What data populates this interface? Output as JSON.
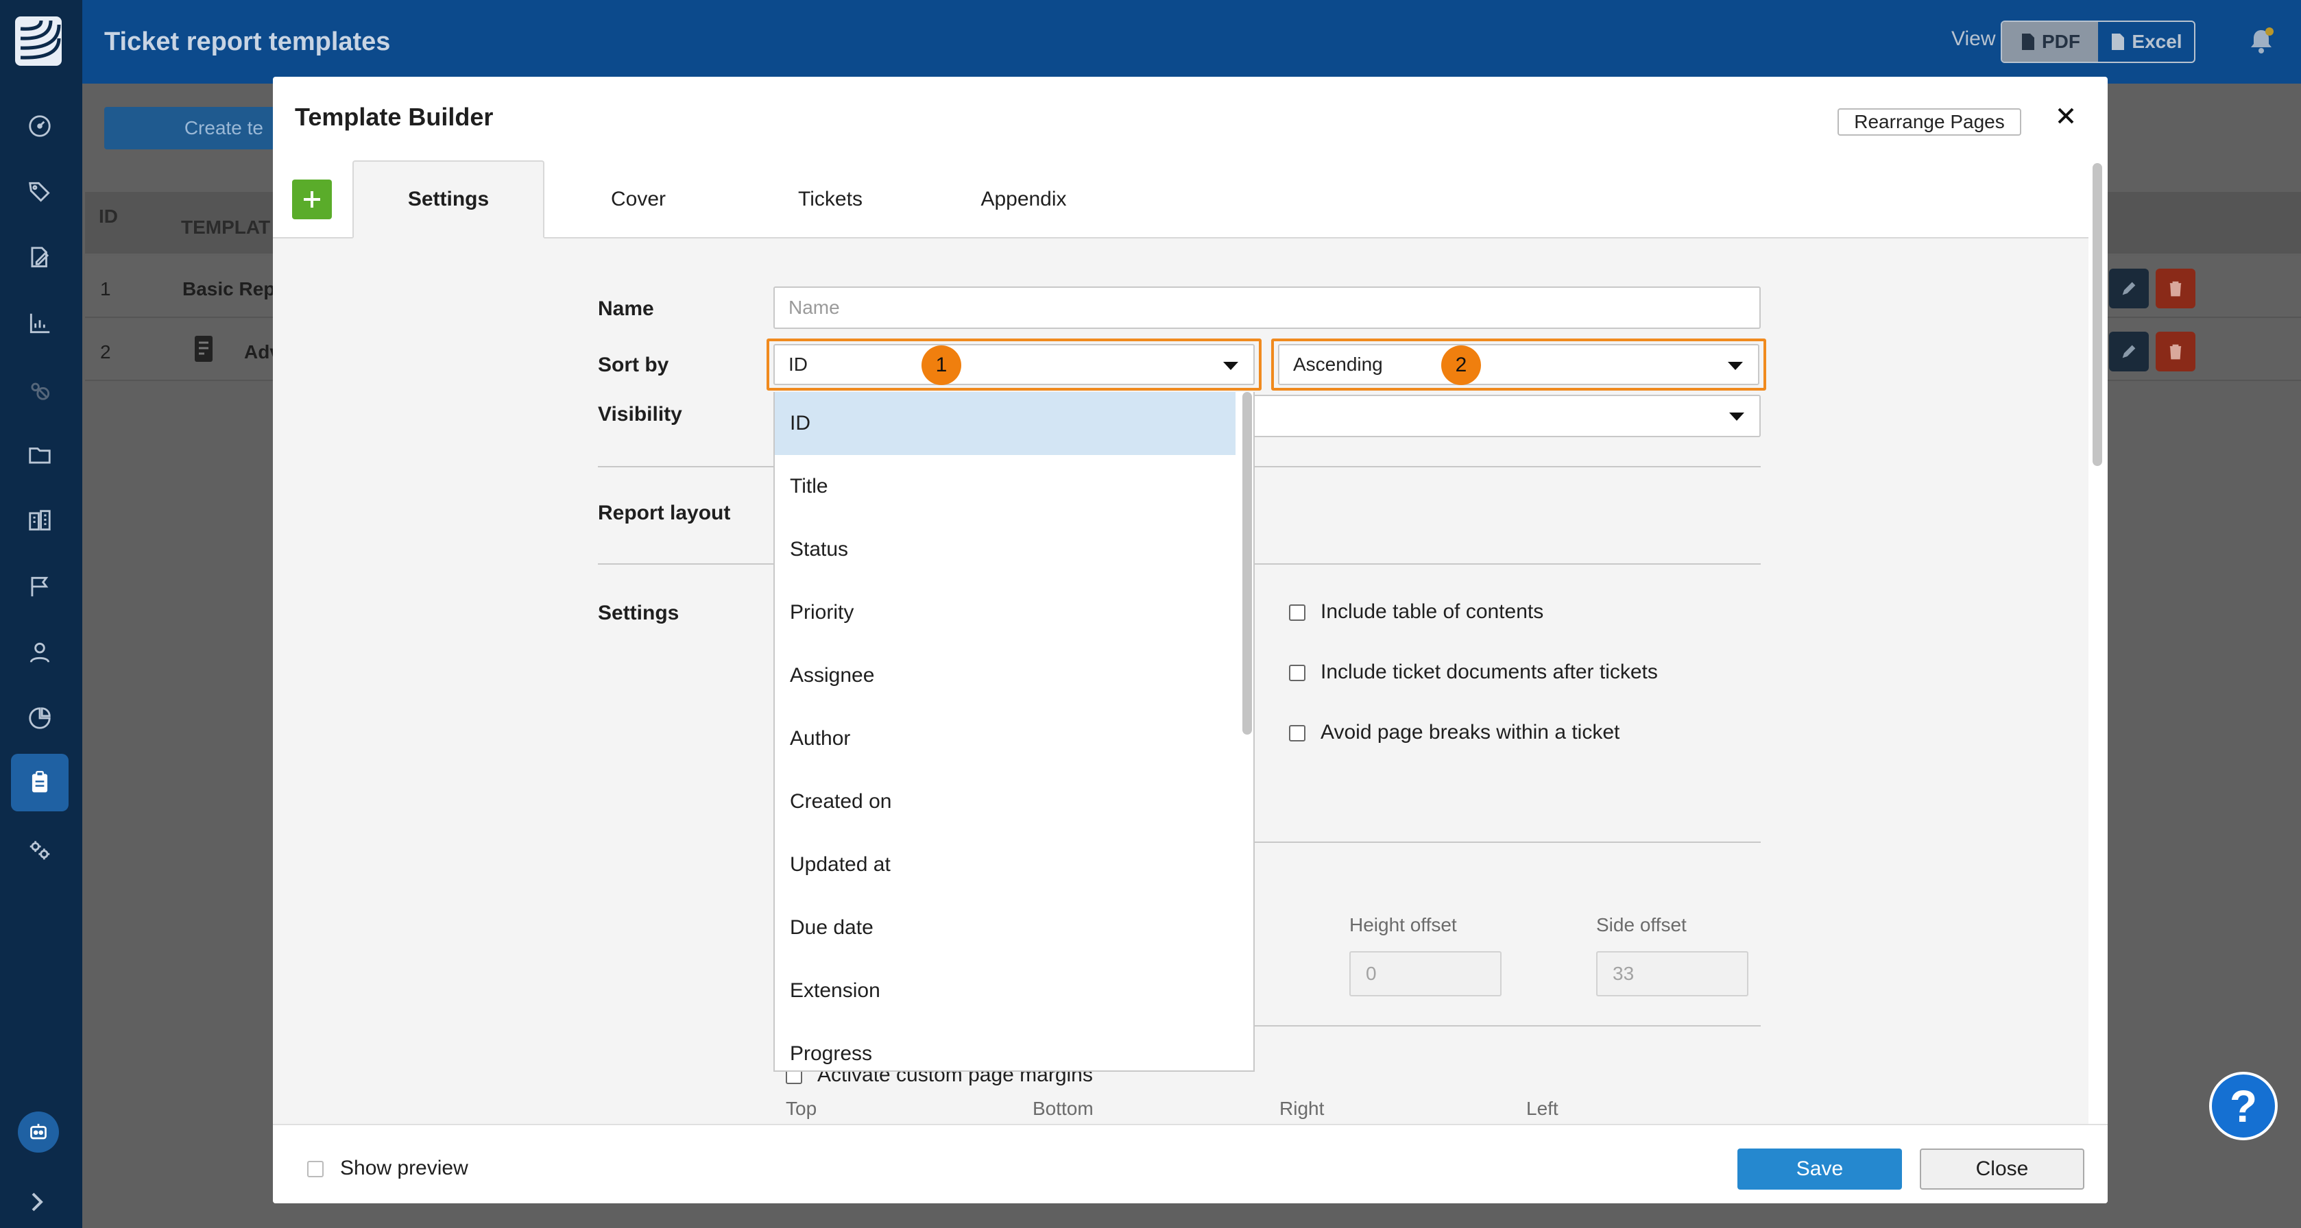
{
  "app": {
    "title": "Ticket report templates",
    "view_label": "View",
    "view_options": [
      "PDF",
      "Excel"
    ],
    "create_button": "Create te"
  },
  "background_table": {
    "headers": [
      "ID",
      "TEMPLAT"
    ],
    "rows": [
      {
        "id": "1",
        "name": "Basic Repo"
      },
      {
        "id": "2",
        "name": "Adv"
      }
    ]
  },
  "modal": {
    "title": "Template Builder",
    "rearrange_button": "Rearrange Pages",
    "tabs": [
      "Settings",
      "Cover",
      "Tickets",
      "Appendix"
    ],
    "active_tab": "Settings",
    "form": {
      "name_label": "Name",
      "name_placeholder": "Name",
      "sort_by_label": "Sort by",
      "sort_field_value": "ID",
      "sort_order_value": "Ascending",
      "visibility_label": "Visibility",
      "report_layout_label": "Report layout",
      "settings_label": "Settings",
      "checkboxes": [
        "Include table of contents",
        "Include ticket documents after tickets",
        "Avoid page breaks within a ticket"
      ],
      "height_offset_label": "Height offset",
      "height_offset_value": "0",
      "side_offset_label": "Side offset",
      "side_offset_value": "33",
      "custom_margins_label": "Activate custom page margins",
      "margin_labels": [
        "Top",
        "Bottom",
        "Right",
        "Left"
      ]
    },
    "sort_dropdown_options": [
      "ID",
      "Title",
      "Status",
      "Priority",
      "Assignee",
      "Author",
      "Created on",
      "Updated at",
      "Due date",
      "Extension",
      "Progress"
    ],
    "annotations": [
      "1",
      "2"
    ],
    "footer": {
      "show_preview_label": "Show preview",
      "save_button": "Save",
      "close_button": "Close"
    }
  },
  "help_button": "?",
  "colors": {
    "brand_navy": "#0c2a4a",
    "topbar_blue": "#0c4a8c",
    "save_blue": "#2588cf",
    "add_green": "#5aac2a",
    "highlight_orange": "#f08a1e",
    "selected_row": "#d3e5f4"
  }
}
